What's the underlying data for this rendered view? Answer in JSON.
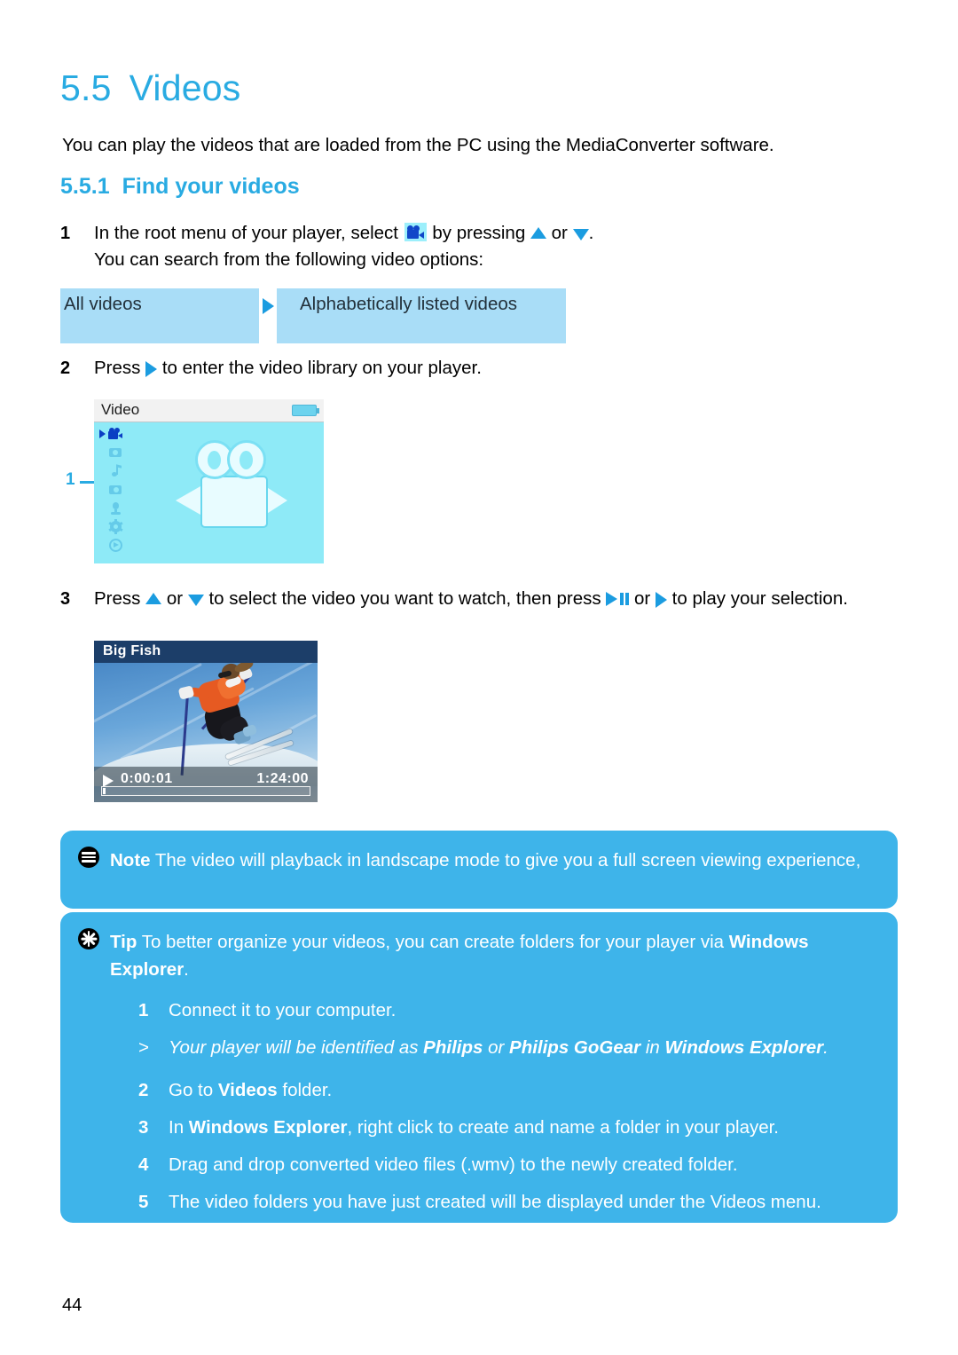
{
  "document": {
    "page_number": "44",
    "heading": {
      "number": "5.5",
      "title": "Videos"
    },
    "intro": "You can play the videos that are loaded from the PC using the MediaConverter software.",
    "subheading": {
      "number": "5.5.1",
      "title": "Find your videos"
    }
  },
  "steps": {
    "step1": {
      "index": "1",
      "text_before_icon": "In the root menu of your player, select",
      "text_after_icon": "by pressing",
      "text_or": "or",
      "text_end": ".",
      "line2": "You can search from the following video options:"
    },
    "step2": {
      "index": "2",
      "text_before_icon": "Press",
      "text_after_icon": "to enter the video library on your player."
    },
    "step3": {
      "index": "3",
      "text_before_icon": "Press",
      "text_or1": "or",
      "text_mid": "to select the video you want to watch, then press",
      "text_or2": "or",
      "text_end": "to play your selection."
    }
  },
  "options_table": {
    "cell1": "All videos",
    "cell2": "Alphabetically listed videos"
  },
  "device_menu_screen": {
    "title": "Video",
    "callout_label": "1",
    "sidebar_icons": [
      "video-camera-icon",
      "camera-icon",
      "music-note-icon",
      "photo-folder-icon",
      "microphone-icon",
      "settings-gear-icon",
      "radio-icon"
    ],
    "main_icon": "video-camera-illustration",
    "battery": "battery-icon"
  },
  "device_playback_screen": {
    "title": "Big Fish",
    "time_current": "0:00:01",
    "time_total": "1:24:00",
    "play_state": "playing",
    "progress_percent": 1
  },
  "note_box": {
    "label": "Note",
    "text": " The video will playback in landscape mode to give you a full screen viewing experience,"
  },
  "tip_box": {
    "label": "Tip",
    "intro_text": " To better organize your videos, you can create folders for your player via ",
    "intro_bold": "Windows Explorer",
    "intro_end": ".",
    "steps": [
      {
        "index": "1",
        "parts": [
          {
            "t": "Connect it to your computer.",
            "b": false
          }
        ]
      },
      {
        "index": ">",
        "italic": true,
        "parts": [
          {
            "t": "Your player will be identified as ",
            "b": false
          },
          {
            "t": "Philips",
            "b": true
          },
          {
            "t": " or ",
            "b": false
          },
          {
            "t": "Philips GoGear",
            "b": true
          },
          {
            "t": " in ",
            "b": false
          },
          {
            "t": "Windows Explorer",
            "b": true
          },
          {
            "t": ".",
            "b": false
          }
        ]
      },
      {
        "index": "2",
        "parts": [
          {
            "t": "Go to ",
            "b": false
          },
          {
            "t": "Videos",
            "b": true
          },
          {
            "t": " folder.",
            "b": false
          }
        ]
      },
      {
        "index": "3",
        "parts": [
          {
            "t": "In ",
            "b": false
          },
          {
            "t": "Windows Explorer",
            "b": true
          },
          {
            "t": ", right click to create and name a folder in your player.",
            "b": false
          }
        ]
      },
      {
        "index": "4",
        "parts": [
          {
            "t": "Drag and drop converted video files (.wmv) to the newly created folder.",
            "b": false
          }
        ]
      },
      {
        "index": "5",
        "parts": [
          {
            "t": "The video folders you have just created will be displayed under the Videos menu.",
            "b": false
          }
        ]
      }
    ]
  },
  "colors": {
    "heading_blue": "#29ABE2",
    "callout_blue": "#3EB4EA",
    "table_cell_blue": "#A9DDF7",
    "device_screen_cyan": "#8EEAF7",
    "arrow_blue": "#1B9CE0"
  }
}
